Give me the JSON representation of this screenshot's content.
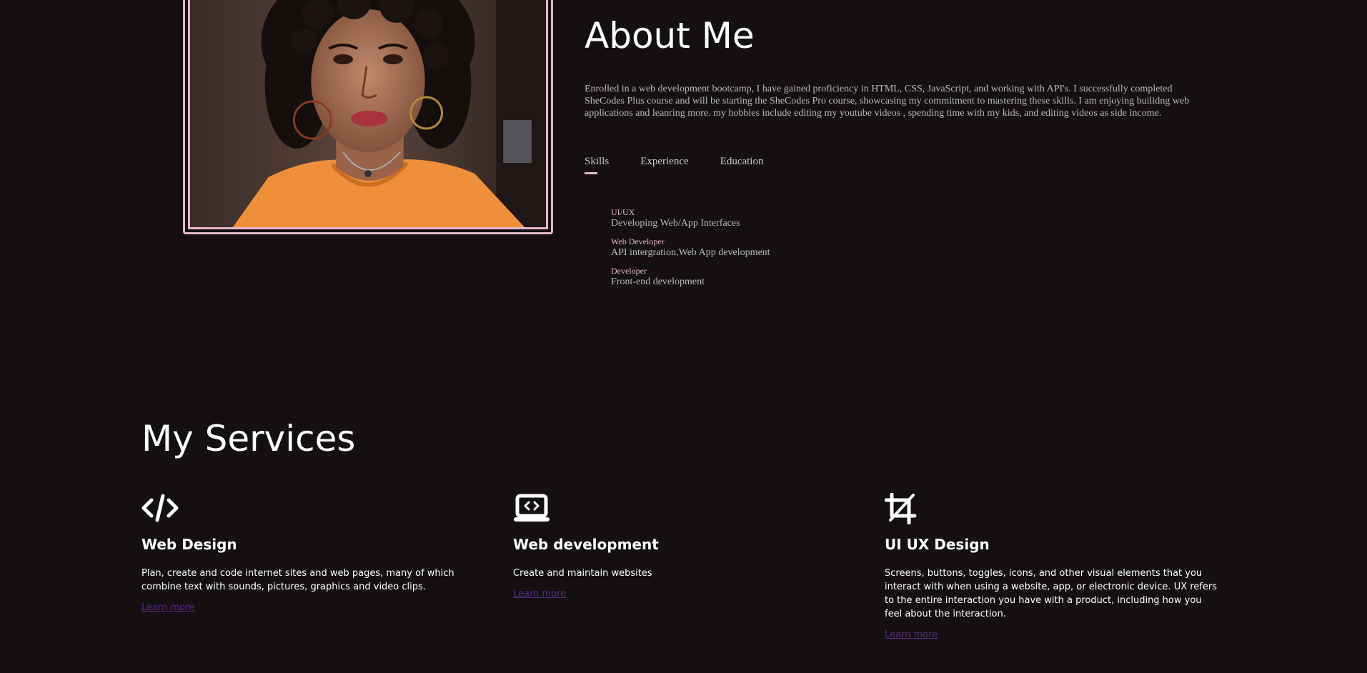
{
  "about": {
    "title": "About Me",
    "description": "Enrolled in a web development bootcamp, I have gained proficiency in HTML, CSS, JavaScript, and working with API's. I successfully completed SheCodes Plus course and will be starting the SheCodes Pro course, showcasing my commitment to mastering these skills. I am enjoying builidng web applications and leanring more. my hobbies include editing my youtube videos , spending time with my kids, and editing videos as side income.",
    "tabs": [
      "Skills",
      "Experience",
      "Education"
    ],
    "active_tab": "Skills",
    "skills": [
      {
        "name": "UI/UX",
        "desc": "Developing Web/App Interfaces"
      },
      {
        "name": "Web Developer",
        "desc": "API intergration,Web App development"
      },
      {
        "name": "Developer",
        "desc": "Front-end development"
      }
    ]
  },
  "services": {
    "title": "My Services",
    "items": [
      {
        "icon": "code-icon",
        "title": "Web Design",
        "desc": "Plan, create and code internet sites and web pages, many of which combine text with sounds, pictures, graphics and video clips.",
        "link": "Learn more"
      },
      {
        "icon": "laptop-code-icon",
        "title": "Web development",
        "desc": "Create and maintain websites",
        "link": "Learn more"
      },
      {
        "icon": "crop-icon",
        "title": "UI UX Design",
        "desc": "Screens, buttons, toggles, icons, and other visual elements that you interact with when using a website, app, or electronic device. UX refers to the entire interaction you have with a product, including how you feel about the interaction.",
        "link": "Learn more"
      }
    ]
  },
  "colors": {
    "background": "#141011",
    "accent_pink": "#e6b8cc",
    "link_purple": "#5b2a86",
    "body_text": "#b9b9b9"
  }
}
